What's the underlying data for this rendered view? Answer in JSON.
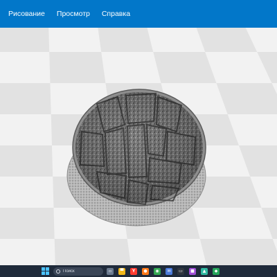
{
  "menubar": {
    "items": [
      {
        "label": "Рисование"
      },
      {
        "label": "Просмотр"
      },
      {
        "label": "Справка"
      }
    ],
    "color": "#0277c9"
  },
  "viewport": {
    "background": "#ececec",
    "model": "textured-stone-round-base"
  },
  "taskbar": {
    "search_placeholder": "Поиск",
    "icons": [
      {
        "name": "task-view-icon",
        "glyph": "▫",
        "color": "#6b7a8f"
      },
      {
        "name": "file-explorer-icon",
        "glyph": "▀",
        "color": "#f2b81b"
      },
      {
        "name": "yandex-browser-icon",
        "glyph": "Y",
        "color": "#ff3b30"
      },
      {
        "name": "firefox-icon",
        "glyph": "●",
        "color": "#ff7a1a"
      },
      {
        "name": "chrome-icon",
        "glyph": "◉",
        "color": "#34a853"
      },
      {
        "name": "mail-icon",
        "glyph": "✉",
        "color": "#4c7bd9"
      },
      {
        "name": "terminal-icon",
        "glyph": "▭",
        "color": "#30363f"
      },
      {
        "name": "notes-icon",
        "glyph": "■",
        "color": "#a04fd6"
      },
      {
        "name": "photos-icon",
        "glyph": "▲",
        "color": "#2fb8a0"
      },
      {
        "name": "app-icon",
        "glyph": "◆",
        "color": "#26a65b"
      }
    ]
  }
}
